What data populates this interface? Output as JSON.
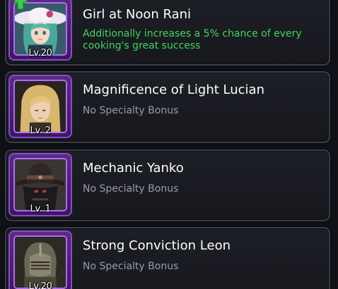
{
  "heroes": [
    {
      "name": "Girl at Noon Rani",
      "level": "Lv.20",
      "bonus": "Additionally increases a 5% chance of every cooking's great success",
      "bonus_color": "#3fd65a",
      "portrait_icon": "rani-portrait"
    },
    {
      "name": "Magnificence of Light Lucian",
      "level": "Lv. 2",
      "bonus": "No Specialty Bonus",
      "bonus_color": "#9a9ca3",
      "portrait_icon": "lucian-portrait"
    },
    {
      "name": "Mechanic Yanko",
      "level": "Lv. 1",
      "bonus": "No Specialty Bonus",
      "bonus_color": "#9a9ca3",
      "portrait_icon": "yanko-portrait"
    },
    {
      "name": "Strong Conviction Leon",
      "level": "Lv.20",
      "bonus": "No Specialty Bonus",
      "bonus_color": "#9a9ca3",
      "portrait_icon": "leon-portrait"
    }
  ],
  "colors": {
    "frame_purple": "#5a2a86",
    "highlight_green": "#3fd65a",
    "card_bg": "#1a1b21"
  }
}
